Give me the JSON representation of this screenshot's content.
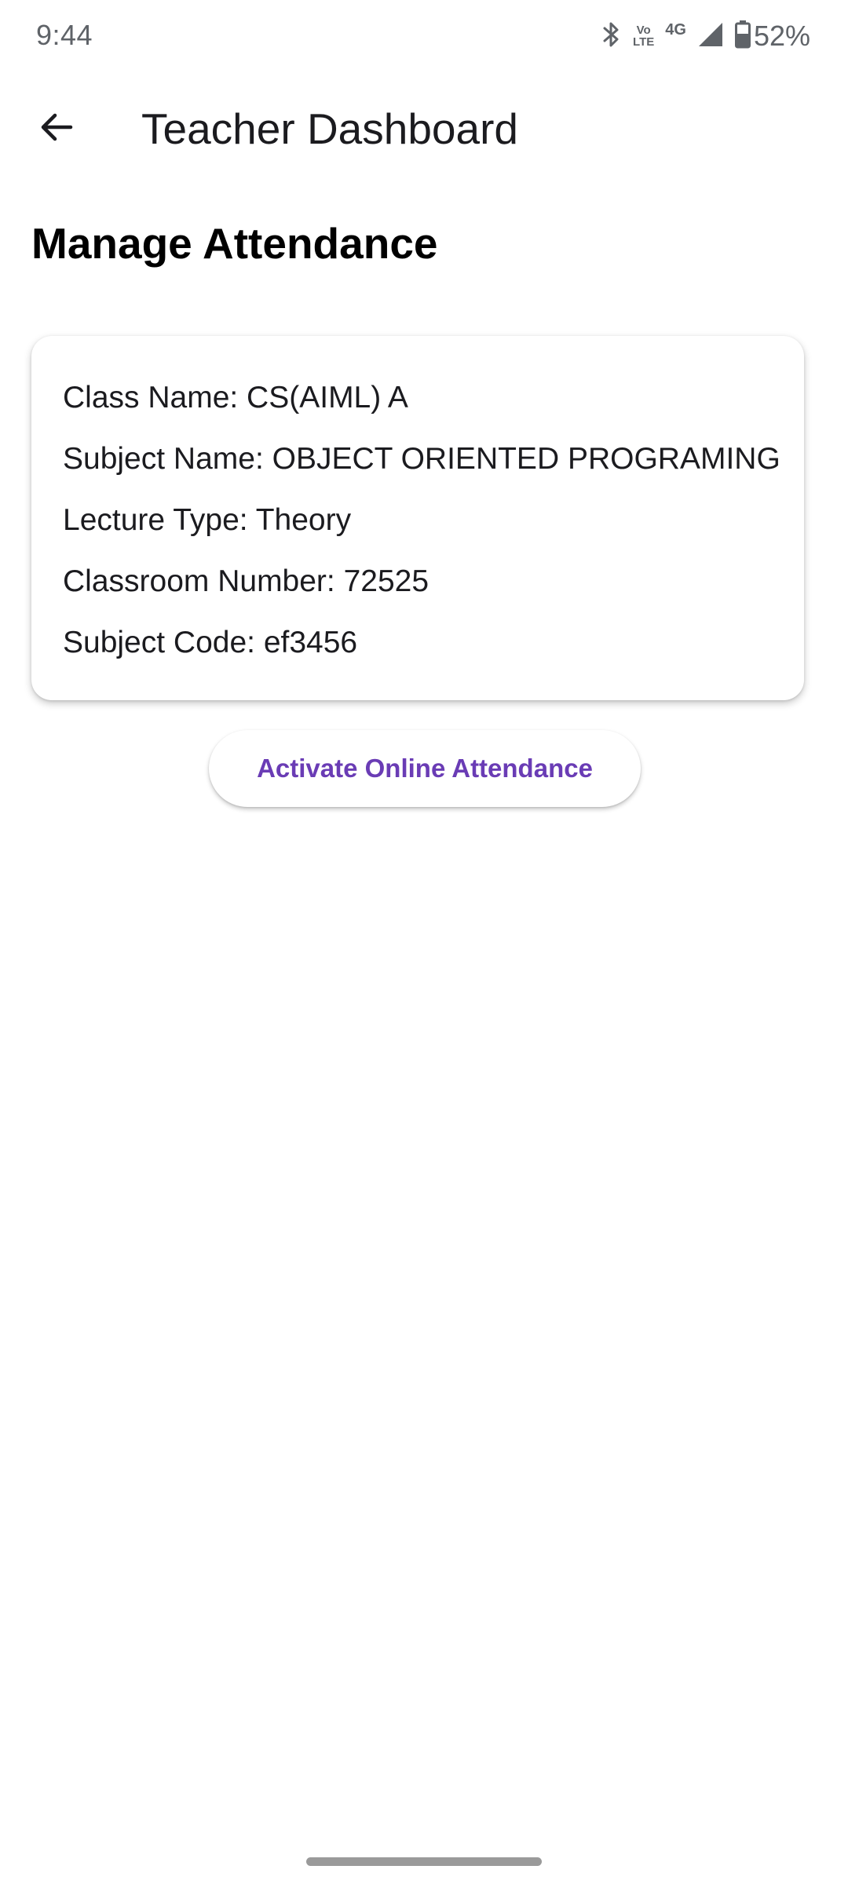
{
  "status_bar": {
    "time": "9:44",
    "volte_top": "Vo",
    "volte_bottom": "LTE",
    "network_type": "4G",
    "battery_percent": "52%",
    "icons": [
      "bluetooth-icon",
      "volte-icon",
      "signal-icon",
      "battery-icon"
    ]
  },
  "app_bar": {
    "title": "Teacher Dashboard",
    "back_icon": "arrow-back-icon"
  },
  "page": {
    "heading": "Manage Attendance"
  },
  "card": {
    "class_name": "Class Name: CS(AIML) A",
    "subject_name": "Subject Name: OBJECT ORIENTED PROGRAMING",
    "lecture_type": "Lecture Type: Theory",
    "classroom_number": "Classroom Number: 72525",
    "subject_code": "Subject Code: ef3456"
  },
  "actions": {
    "activate_label": "Activate Online Attendance"
  },
  "colors": {
    "accent": "#6a3cb5",
    "text": "#1b1b1f",
    "status": "#5f6368"
  }
}
